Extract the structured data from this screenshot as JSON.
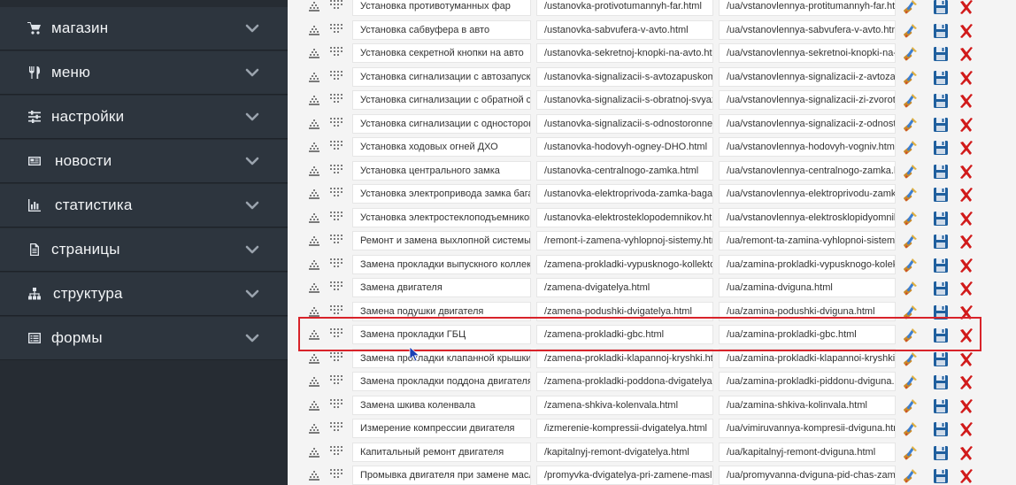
{
  "sidebar": {
    "items": [
      {
        "label": "магазин",
        "icon": "cart-icon"
      },
      {
        "label": "меню",
        "icon": "cutlery-icon"
      },
      {
        "label": "настройки",
        "icon": "sliders-icon"
      },
      {
        "label": "новости",
        "icon": "newspaper-icon"
      },
      {
        "label": "статистика",
        "icon": "bar-chart-icon"
      },
      {
        "label": "страницы",
        "icon": "file-icon"
      },
      {
        "label": "структура",
        "icon": "sitemap-icon"
      },
      {
        "label": "формы",
        "icon": "form-icon"
      }
    ]
  },
  "rows": [
    {
      "name": "Установка противотуманных фар",
      "url": "/ustanovka-protivotumannyh-far.html",
      "ua_url": "/ua/vstanovlennya-protitumannyh-far.html"
    },
    {
      "name": "Установка сабвуфера в авто",
      "url": "/ustanovka-sabvufera-v-avto.html",
      "ua_url": "/ua/vstanovlennya-sabvufera-v-avto.html"
    },
    {
      "name": "Установка секретной кнопки на авто",
      "url": "/ustanovka-sekretnoj-knopki-na-avto.html",
      "ua_url": "/ua/vstanovlennya-sekretnoi-knopki-na-avto.html"
    },
    {
      "name": "Установка сигнализации с автозапуском",
      "url": "/ustanovka-signalizacii-s-avtozapuskom.html",
      "ua_url": "/ua/vstanovlennya-signalizacii-z-avtozapuskom.html"
    },
    {
      "name": "Установка сигнализации с обратной связью",
      "url": "/ustanovka-signalizacii-s-obratnoj-svyazyu.html",
      "ua_url": "/ua/vstanovlennya-signalizacii-zi-zvorotnim.html"
    },
    {
      "name": "Установка сигнализации с односторонней",
      "url": "/ustanovka-signalizacii-s-odnostoronnej.html",
      "ua_url": "/ua/vstanovlennya-signalizacii-z-odnostoronnim.html"
    },
    {
      "name": "Установка ходовых огней ДХО",
      "url": "/ustanovka-hodovyh-ogney-DHO.html",
      "ua_url": "/ua/vstanovlennya-hodovyh-vogniv.html"
    },
    {
      "name": "Установка центрального замка",
      "url": "/ustanovka-centralnogo-zamka.html",
      "ua_url": "/ua/vstanovlennya-centralnogo-zamka.html"
    },
    {
      "name": "Установка электропривода замка багажника",
      "url": "/ustanovka-elektroprivoda-zamka-bagazhnika.html",
      "ua_url": "/ua/vstanovlennya-elektroprivodu-zamka.html"
    },
    {
      "name": "Установка электростеклоподъемников",
      "url": "/ustanovka-elektrosteklopodemnikov.html",
      "ua_url": "/ua/vstanovlennya-elektrosklopidyomnikiv.html"
    },
    {
      "name": "Ремонт и замена выхлопной системы",
      "url": "/remont-i-zamena-vyhlopnoj-sistemy.html",
      "ua_url": "/ua/remont-ta-zamina-vyhlopnoi-sistemi.html"
    },
    {
      "name": "Замена прокладки выпускного коллектора",
      "url": "/zamena-prokladki-vypusknogo-kollektora.html",
      "ua_url": "/ua/zamina-prokladki-vypusknogo-kolektora.html"
    },
    {
      "name": "Замена двигателя",
      "url": "/zamena-dvigatelya.html",
      "ua_url": "/ua/zamina-dviguna.html"
    },
    {
      "name": "Замена подушки двигателя",
      "url": "/zamena-podushki-dvigatelya.html",
      "ua_url": "/ua/zamina-podushki-dviguna.html"
    },
    {
      "name": "Замена прокладки ГБЦ",
      "url": "/zamena-prokladki-gbc.html",
      "ua_url": "/ua/zamina-prokladki-gbc.html"
    },
    {
      "name": "Замена прокладки клапанной крышки",
      "url": "/zamena-prokladki-klapannoj-kryshki.html",
      "ua_url": "/ua/zamina-prokladki-klapannoi-kryshki.html"
    },
    {
      "name": "Замена прокладки поддона двигателя",
      "url": "/zamena-prokladki-poddona-dvigatelya.html",
      "ua_url": "/ua/zamina-prokladki-piddonu-dviguna.html"
    },
    {
      "name": "Замена шкива коленвала",
      "url": "/zamena-shkiva-kolenvala.html",
      "ua_url": "/ua/zamina-shkiva-kolinvala.html"
    },
    {
      "name": "Измерение компрессии двигателя",
      "url": "/izmerenie-kompressii-dvigatelya.html",
      "ua_url": "/ua/vimiruvannya-kompresii-dviguna.html"
    },
    {
      "name": "Капитальный ремонт двигателя",
      "url": "/kapitalnyj-remont-dvigatelya.html",
      "ua_url": "/ua/kapitalnyj-remont-dviguna.html"
    },
    {
      "name": "Промывка двигателя при замене масла",
      "url": "/promyvka-dvigatelya-pri-zamene-masla.html",
      "ua_url": "/ua/promyvanna-dviguna-pid-chas-zamini.html"
    }
  ],
  "highlighted_row": 14,
  "colors": {
    "sidebar_bg": "#262c33",
    "sidebar_item_bg": "#2d353e",
    "highlight": "#d8232a",
    "save": "#1f5f9e",
    "delete": "#d11a1a"
  }
}
